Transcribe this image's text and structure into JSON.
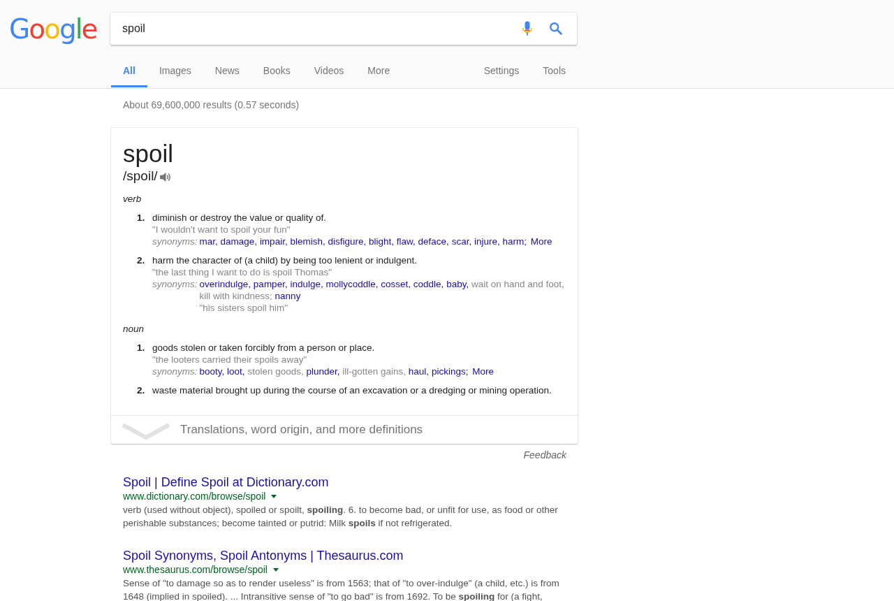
{
  "logo": "Google",
  "search": {
    "value": "spoil"
  },
  "tabs": [
    {
      "label": "All",
      "selected": true
    },
    {
      "label": "Images",
      "selected": false
    },
    {
      "label": "News",
      "selected": false
    },
    {
      "label": "Books",
      "selected": false
    },
    {
      "label": "Videos",
      "selected": false
    },
    {
      "label": "More",
      "selected": false
    }
  ],
  "tools": [
    "Settings",
    "Tools"
  ],
  "result_stats": "About 69,600,000 results (0.57 seconds)",
  "dictionary": {
    "word": "spoil",
    "pronunciation": "/spoil/",
    "groups": [
      {
        "part_of_speech": "verb",
        "senses": [
          {
            "number": "1.",
            "definition": "diminish or destroy the value or quality of.",
            "example": "\"I wouldn't want to spoil your fun\"",
            "synonyms_label": "synonyms:",
            "synonyms": [
              {
                "text": "mar",
                "linked": true,
                "sep": ","
              },
              {
                "text": "damage",
                "linked": true,
                "sep": ","
              },
              {
                "text": "impair",
                "linked": true,
                "sep": ","
              },
              {
                "text": "blemish",
                "linked": true,
                "sep": ","
              },
              {
                "text": "disfigure",
                "linked": true,
                "sep": ","
              },
              {
                "text": "blight",
                "linked": true,
                "sep": ","
              },
              {
                "text": "flaw",
                "linked": true,
                "sep": ","
              },
              {
                "text": "deface",
                "linked": true,
                "sep": ","
              },
              {
                "text": "scar",
                "linked": true,
                "sep": ","
              },
              {
                "text": "injure",
                "linked": true,
                "sep": ","
              },
              {
                "text": "harm",
                "linked": true,
                "sep": ";"
              }
            ],
            "more": "More"
          },
          {
            "number": "2.",
            "definition": "harm the character of (a child) by being too lenient or indulgent.",
            "example": "\"the last thing I want to do is spoil Thomas\"",
            "synonyms_label": "synonyms:",
            "synonyms": [
              {
                "text": "overindulge",
                "linked": true,
                "sep": ","
              },
              {
                "text": "pamper",
                "linked": true,
                "sep": ","
              },
              {
                "text": "indulge",
                "linked": true,
                "sep": ","
              },
              {
                "text": "mollycoddle",
                "linked": true,
                "sep": ","
              },
              {
                "text": "cosset",
                "linked": true,
                "sep": ","
              },
              {
                "text": "coddle",
                "linked": true,
                "sep": ","
              },
              {
                "text": "baby",
                "linked": true,
                "sep": ","
              },
              {
                "text": "wait on hand and foot",
                "linked": false,
                "sep": ","
              },
              {
                "text": "kill with kindness",
                "linked": false,
                "sep": ";"
              },
              {
                "text": "nanny",
                "linked": true
              }
            ],
            "synonym_example": "\"his sisters spoil him\""
          }
        ]
      },
      {
        "part_of_speech": "noun",
        "senses": [
          {
            "number": "1.",
            "definition": "goods stolen or taken forcibly from a person or place.",
            "example": "\"the looters carried their spoils away\"",
            "synonyms_label": "synonyms:",
            "synonyms": [
              {
                "text": "booty",
                "linked": true,
                "sep": ","
              },
              {
                "text": "loot",
                "linked": true,
                "sep": ","
              },
              {
                "text": "stolen goods",
                "linked": false,
                "sep": ","
              },
              {
                "text": "plunder",
                "linked": true,
                "sep": ","
              },
              {
                "text": "ill-gotten gains",
                "linked": false,
                "sep": ","
              },
              {
                "text": "haul",
                "linked": true,
                "sep": ","
              },
              {
                "text": "pickings",
                "linked": true,
                "sep": ";"
              }
            ],
            "more": "More"
          },
          {
            "number": "2.",
            "definition": "waste material brought up during the course of an excavation or a dredging or mining operation."
          }
        ]
      }
    ],
    "expand_label": "Translations, word origin, and more definitions"
  },
  "feedback": "Feedback",
  "results": [
    {
      "title": "Spoil | Define Spoil at Dictionary.com",
      "url": "www.dictionary.com/browse/spoil",
      "snippet": "verb (used without object), spoiled or spoilt, **spoiling**. 6. to become bad, or unfit for use, as food or other perishable substances; become tainted or putrid: Milk **spoils** if not refrigerated."
    },
    {
      "title": "Spoil Synonyms, Spoil Antonyms | Thesaurus.com",
      "url": "www.thesaurus.com/browse/spoil",
      "snippet": "Sense of \"to damage so as to render useless\" is from 1563; that of \"to over-indulge\" (a child, etc.) is from 1648 (implied in spoiled). ... Intransitive sense of \"to go bad\" is from 1692. To be **spoiling** for (a fight,"
    }
  ]
}
